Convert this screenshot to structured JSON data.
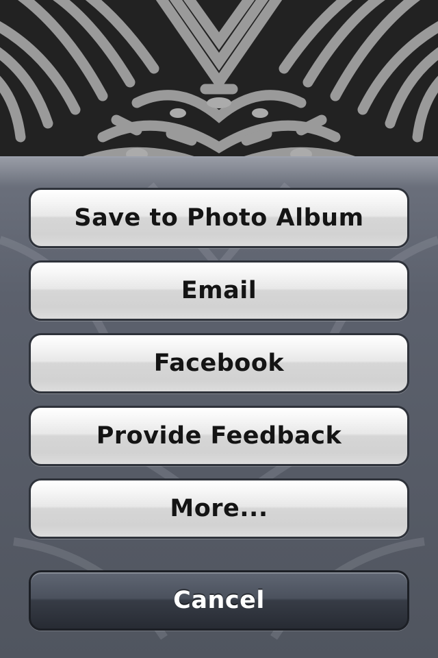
{
  "action_sheet": {
    "buttons": [
      {
        "label": "Save to Photo Album"
      },
      {
        "label": "Email"
      },
      {
        "label": "Facebook"
      },
      {
        "label": "Provide Feedback"
      },
      {
        "label": "More..."
      }
    ],
    "cancel_label": "Cancel"
  },
  "colors": {
    "sheet_background": "#5c616d",
    "button_light": "#e8e8e8",
    "button_dark": "#373c46"
  }
}
